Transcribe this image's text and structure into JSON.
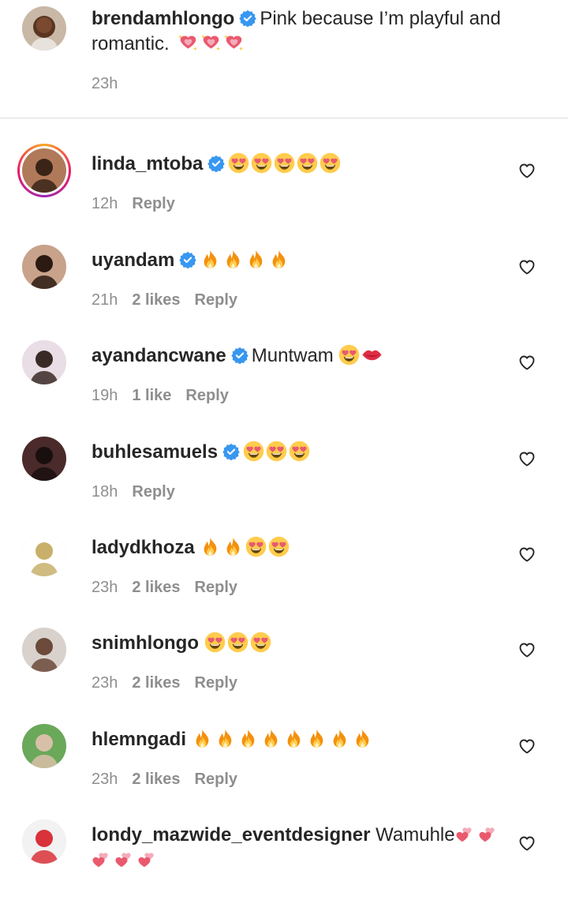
{
  "caption": {
    "username": "brendamhlongo",
    "text_line1": "Pink because I’m playful and",
    "text_line2": "romantic.",
    "time": "23h",
    "verified": true
  },
  "comments": [
    {
      "username": "linda_mtoba",
      "verified": true,
      "text": "",
      "emojis": [
        "heart-eyes",
        "heart-eyes",
        "heart-eyes",
        "heart-eyes",
        "heart-eyes"
      ],
      "time": "12h",
      "likes": "",
      "reply": "Reply",
      "story": true
    },
    {
      "username": "uyandam",
      "verified": true,
      "text": "",
      "emojis": [
        "fire",
        "fire",
        "fire",
        "fire"
      ],
      "time": "21h",
      "likes": "2 likes",
      "reply": "Reply"
    },
    {
      "username": "ayandancwane",
      "verified": true,
      "text": "Muntwam",
      "emojis": [
        "heart-eyes",
        "kiss-lips"
      ],
      "time": "19h",
      "likes": "1 like",
      "reply": "Reply"
    },
    {
      "username": "buhlesamuels",
      "verified": true,
      "text": "",
      "emojis": [
        "heart-eyes",
        "heart-eyes",
        "heart-eyes"
      ],
      "time": "18h",
      "likes": "",
      "reply": "Reply"
    },
    {
      "username": "ladydkhoza",
      "verified": false,
      "text": "",
      "emojis": [
        "fire",
        "fire",
        "heart-eyes",
        "heart-eyes"
      ],
      "time": "23h",
      "likes": "2 likes",
      "reply": "Reply"
    },
    {
      "username": "snimhlongo",
      "verified": false,
      "text": "",
      "emojis": [
        "heart-eyes",
        "heart-eyes",
        "heart-eyes"
      ],
      "time": "23h",
      "likes": "2 likes",
      "reply": "Reply"
    },
    {
      "username": "hlemngadi",
      "verified": false,
      "text": "",
      "emojis": [
        "fire",
        "fire",
        "fire",
        "fire",
        "fire",
        "fire",
        "fire",
        "fire"
      ],
      "time": "23h",
      "likes": "2 likes",
      "reply": "Reply"
    },
    {
      "username": "londy_mazwide_eventdesigner",
      "verified": false,
      "text": "Wamuhle",
      "emojis": [
        "two-hearts",
        "two-hearts"
      ],
      "emojis_line2": [
        "two-hearts",
        "two-hearts",
        "two-hearts"
      ],
      "time": "",
      "likes": "",
      "reply": ""
    }
  ],
  "colors": {
    "verified": "#3897f0",
    "meta": "#8e8e8e",
    "text": "#262626"
  }
}
